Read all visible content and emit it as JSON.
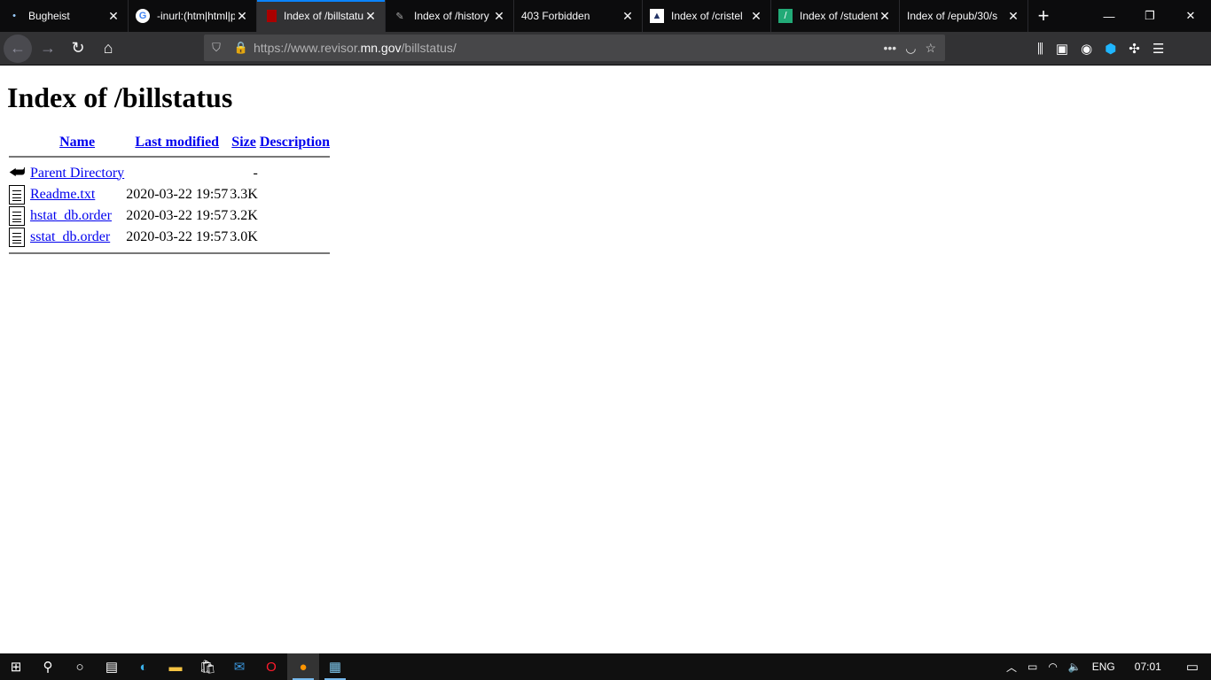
{
  "browser": {
    "tabs": [
      {
        "title": "Bugheist",
        "icon": "dot-icon",
        "active": false
      },
      {
        "title": "-inurl:(htm|html|php)",
        "icon": "google-icon",
        "active": false
      },
      {
        "title": "Index of /billstatus/",
        "icon": "minnesota-icon",
        "active": true
      },
      {
        "title": "Index of /history",
        "icon": "feather-icon",
        "active": false
      },
      {
        "title": "403 Forbidden",
        "icon": "",
        "active": false
      },
      {
        "title": "Index of /cristel",
        "icon": "site-icon",
        "active": false
      },
      {
        "title": "Index of /students",
        "icon": "site-icon",
        "active": false
      },
      {
        "title": "Index of /epub/30/s",
        "icon": "",
        "active": false
      }
    ],
    "url_prefix": "https://www.revisor.",
    "url_domain": "mn.gov",
    "url_suffix": "/billstatus/",
    "accent": "#0a84ff"
  },
  "page": {
    "title": "Index of /billstatus",
    "headers": {
      "name": "Name",
      "modified": "Last modified",
      "size": "Size",
      "description": "Description"
    },
    "parent": {
      "name": "Parent Directory",
      "size": "-"
    },
    "rows": [
      {
        "name": "Readme.txt",
        "modified": "2020-03-22 19:57",
        "size": "3.3K"
      },
      {
        "name": "hstat_db.order",
        "modified": "2020-03-22 19:57",
        "size": "3.2K"
      },
      {
        "name": "sstat_db.order",
        "modified": "2020-03-22 19:57",
        "size": "3.0K"
      }
    ]
  },
  "taskbar": {
    "lang": "ENG",
    "time": "07:01"
  }
}
